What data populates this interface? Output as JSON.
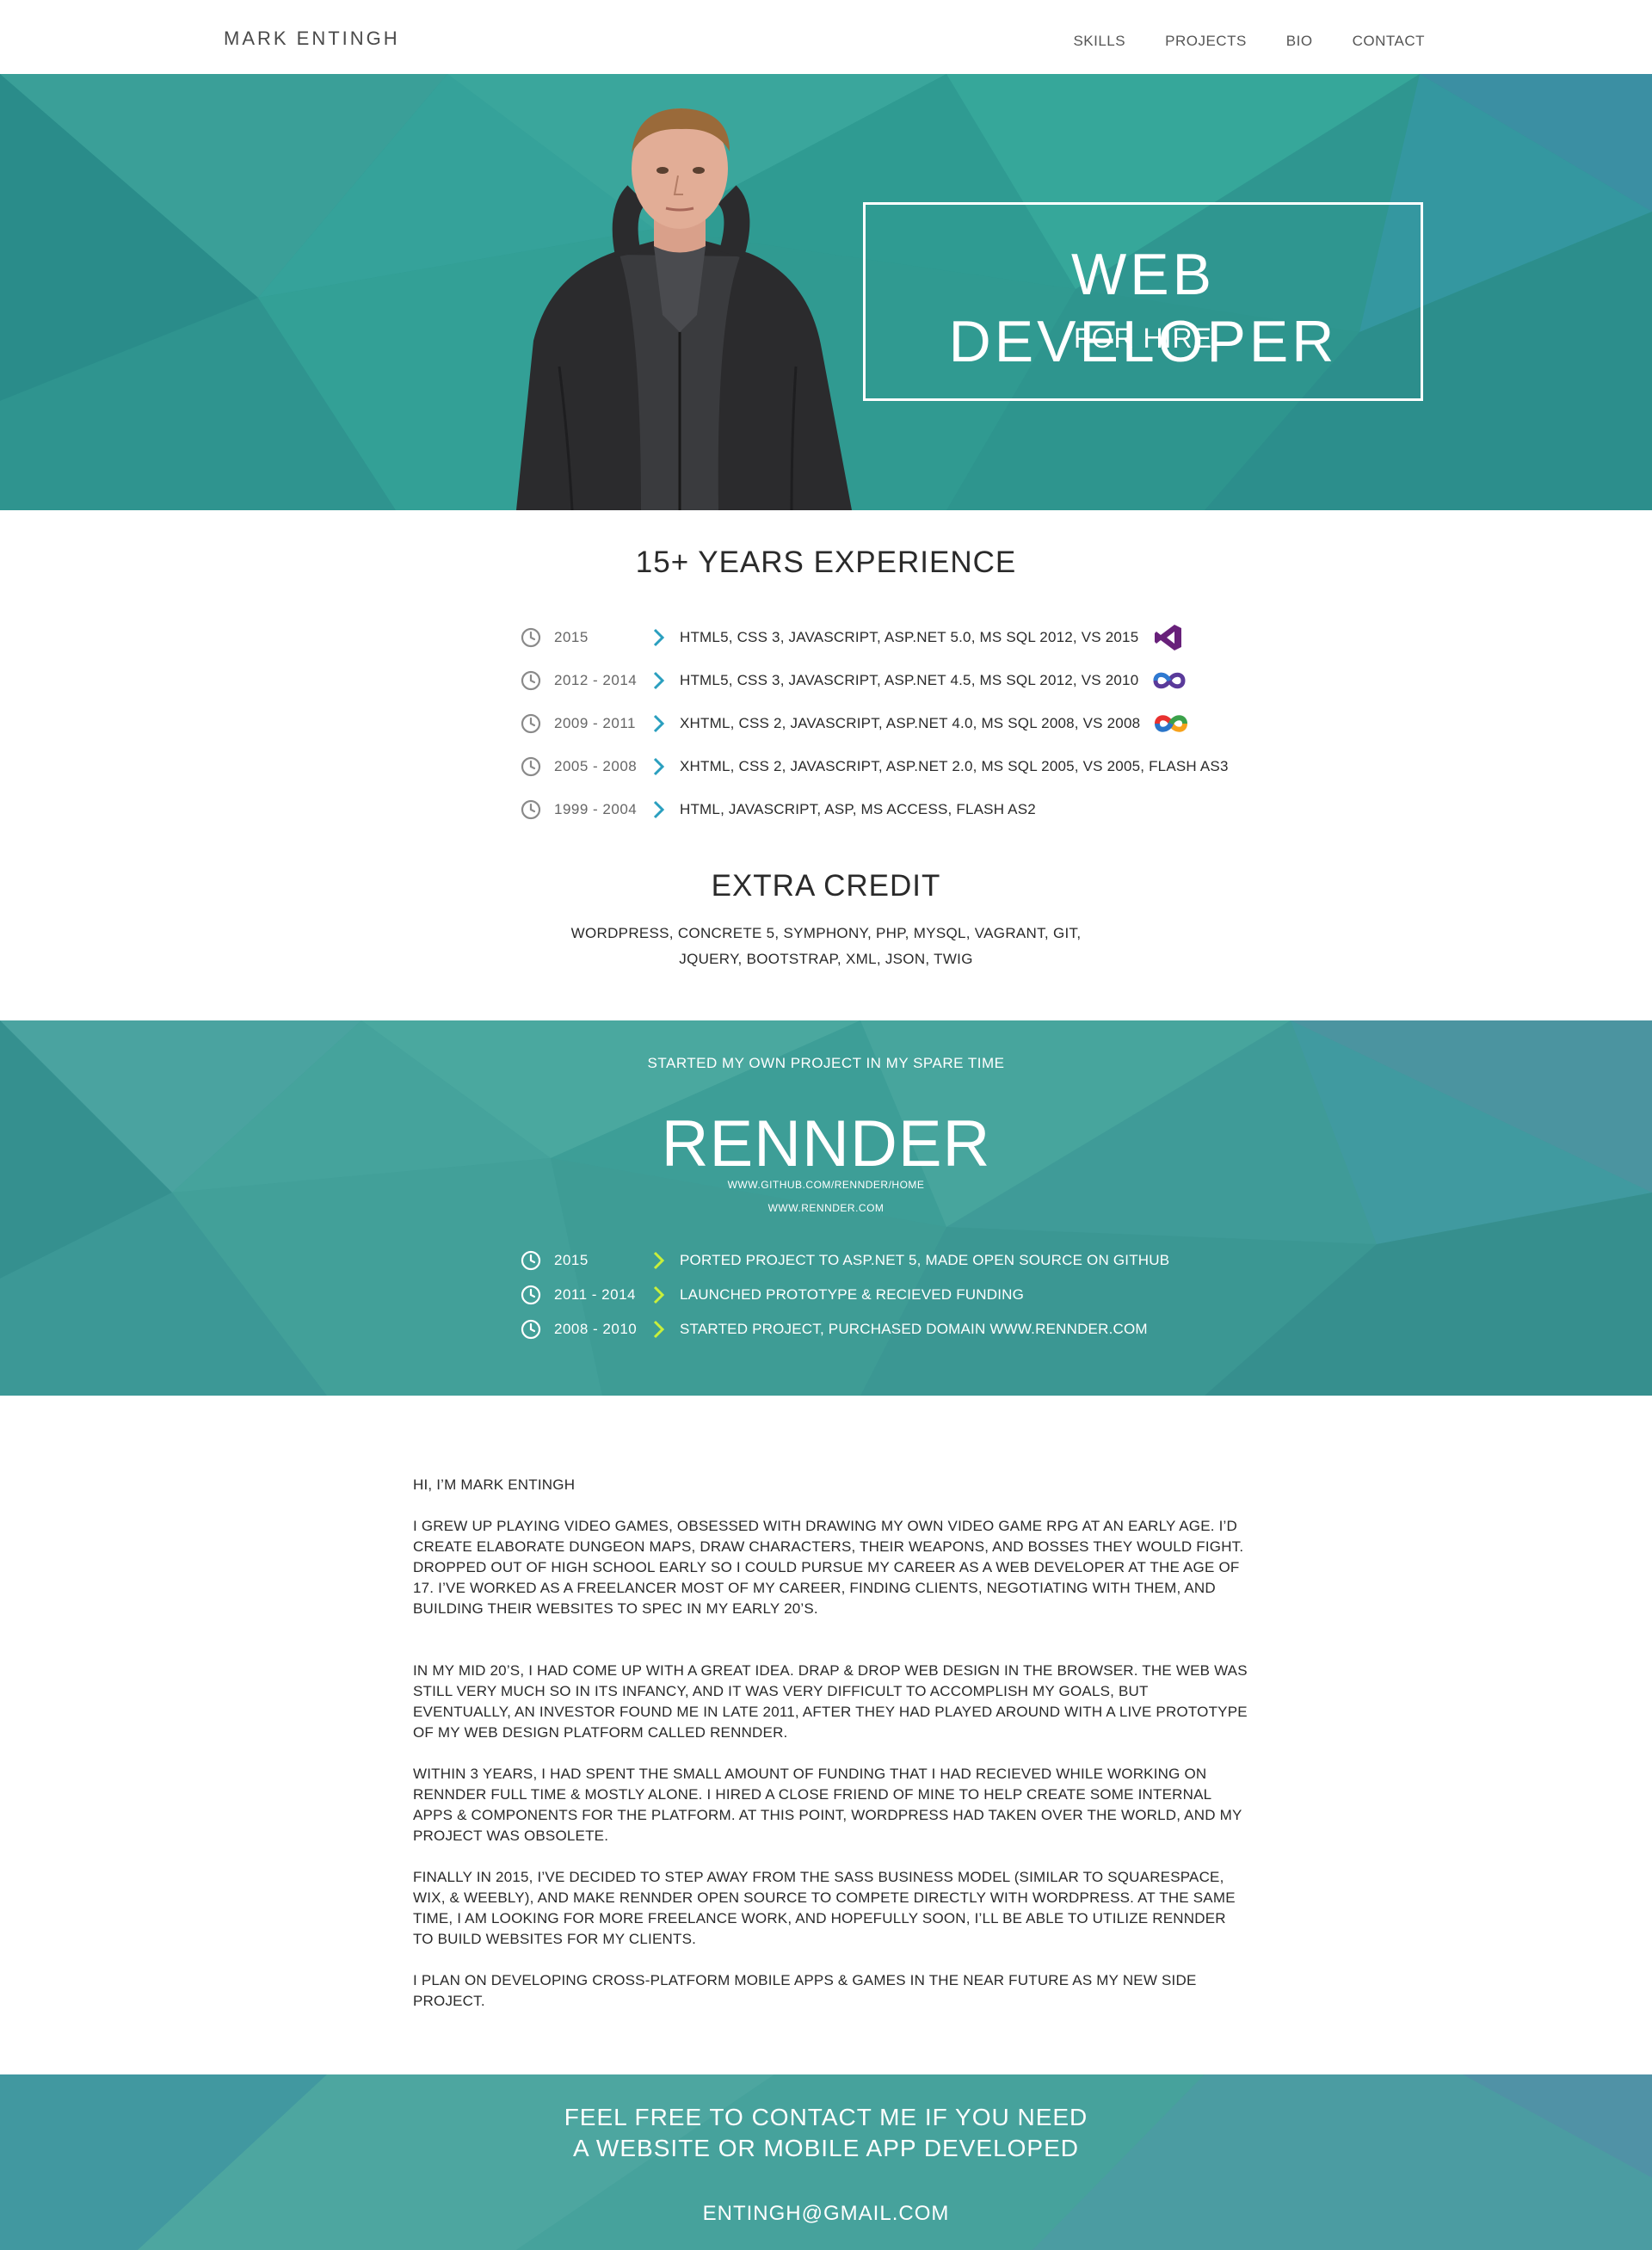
{
  "nav": {
    "brand": "MARK ENTINGH",
    "links": [
      "SKILLS",
      "PROJECTS",
      "BIO",
      "CONTACT"
    ]
  },
  "hero": {
    "title": "WEB  DEVELOPER",
    "subtitle": "FOR HIRE"
  },
  "experience": {
    "title": "15+ YEARS EXPERIENCE",
    "rows": [
      {
        "years": "2015",
        "desc": "HTML5, CSS 3, JAVASCRIPT, ASP.NET 5.0, MS SQL 2012, VS 2015",
        "logo": "visual-studio-2015-logo"
      },
      {
        "years": "2012 - 2014",
        "desc": "HTML5, CSS 3, JAVASCRIPT, ASP.NET 4.5, MS SQL 2012, VS 2010",
        "logo": "visual-studio-2010-logo"
      },
      {
        "years": "2009 - 2011",
        "desc": "XHTML, CSS 2, JAVASCRIPT, ASP.NET 4.0, MS SQL 2008, VS 2008",
        "logo": "visual-studio-2008-logo"
      },
      {
        "years": "2005 - 2008",
        "desc": "XHTML, CSS 2, JAVASCRIPT, ASP.NET 2.0, MS SQL 2005, VS 2005, FLASH AS3",
        "logo": ""
      },
      {
        "years": "1999 - 2004",
        "desc": "HTML, JAVASCRIPT, ASP, MS ACCESS, FLASH AS2",
        "logo": ""
      }
    ]
  },
  "extra": {
    "title": "EXTRA CREDIT",
    "line1": "WORDPRESS, CONCRETE 5, SYMPHONY, PHP, MYSQL, VAGRANT, GIT,",
    "line2": "JQUERY, BOOTSTRAP, XML, JSON, TWIG"
  },
  "project": {
    "kicker": "STARTED MY OWN PROJECT IN MY SPARE TIME",
    "name": "RENNDER",
    "url1": "WWW.GITHUB.COM/RENNDER/HOME",
    "url2": "WWW.RENNDER.COM",
    "rows": [
      {
        "years": "2015",
        "desc": "PORTED PROJECT TO ASP.NET 5, MADE OPEN SOURCE ON GITHUB"
      },
      {
        "years": "2011 - 2014",
        "desc": "LAUNCHED PROTOTYPE & RECIEVED FUNDING"
      },
      {
        "years": "2008 - 2010",
        "desc": "STARTED PROJECT, PURCHASED DOMAIN WWW.RENNDER.COM"
      }
    ]
  },
  "bio": {
    "greeting": "HI, I’M MARK ENTINGH",
    "p1": "I GREW UP PLAYING VIDEO GAMES, OBSESSED WITH DRAWING MY OWN VIDEO GAME RPG AT AN EARLY AGE. I’D CREATE ELABORATE DUNGEON MAPS, DRAW CHARACTERS, THEIR WEAPONS, AND BOSSES THEY WOULD FIGHT. DROPPED OUT OF HIGH SCHOOL EARLY SO I COULD PURSUE MY CAREER AS A WEB DEVELOPER AT THE AGE OF 17. I’VE WORKED AS A FREELANCER MOST OF MY CAREER, FINDING CLIENTS, NEGOTIATING WITH THEM, AND BUILDING THEIR WEBSITES TO SPEC IN MY EARLY 20’S.",
    "p2": "IN MY MID 20’S, I HAD COME UP WITH A GREAT IDEA. DRAP & DROP WEB DESIGN IN THE BROWSER. THE WEB WAS STILL VERY MUCH SO IN ITS INFANCY, AND IT WAS VERY DIFFICULT TO ACCOMPLISH MY GOALS, BUT EVENTUALLY, AN INVESTOR FOUND ME IN LATE 2011, AFTER THEY HAD PLAYED AROUND WITH A LIVE PROTOTYPE OF MY WEB DESIGN PLATFORM CALLED RENNDER.",
    "p3": "WITHIN 3 YEARS, I HAD SPENT THE SMALL AMOUNT OF FUNDING THAT I HAD RECIEVED WHILE WORKING ON RENNDER FULL TIME & MOSTLY ALONE. I HIRED A CLOSE FRIEND OF MINE TO HELP CREATE SOME INTERNAL APPS & COMPONENTS FOR THE PLATFORM. AT THIS POINT, WORDPRESS HAD TAKEN OVER THE WORLD, AND MY PROJECT WAS OBSOLETE.",
    "p4": "FINALLY IN 2015, I’VE DECIDED TO STEP AWAY FROM THE SASS BUSINESS MODEL (SIMILAR TO SQUARESPACE, WIX, & WEEBLY), AND MAKE RENNDER OPEN SOURCE TO COMPETE DIRECTLY WITH WORDPRESS. AT THE SAME TIME, I AM LOOKING FOR MORE FREELANCE WORK, AND HOPEFULLY SOON, I’LL BE ABLE TO UTILIZE RENNDER TO BUILD WEBSITES FOR MY CLIENTS.",
    "p5": "I PLAN ON DEVELOPING CROSS-PLATFORM MOBILE APPS & GAMES IN THE NEAR FUTURE AS MY NEW SIDE PROJECT."
  },
  "contact": {
    "line1": "FEEL FREE TO CONTACT ME IF YOU NEED",
    "line2": "A WEBSITE OR MOBILE APP DEVELOPED",
    "email": "ENTINGH@GMAIL.COM"
  },
  "colors": {
    "teal": "#2f9a94",
    "chevron_dark": "#2a9fbf",
    "chevron_light": "#c9ef3a",
    "clock_gray": "#8a8a8a"
  }
}
